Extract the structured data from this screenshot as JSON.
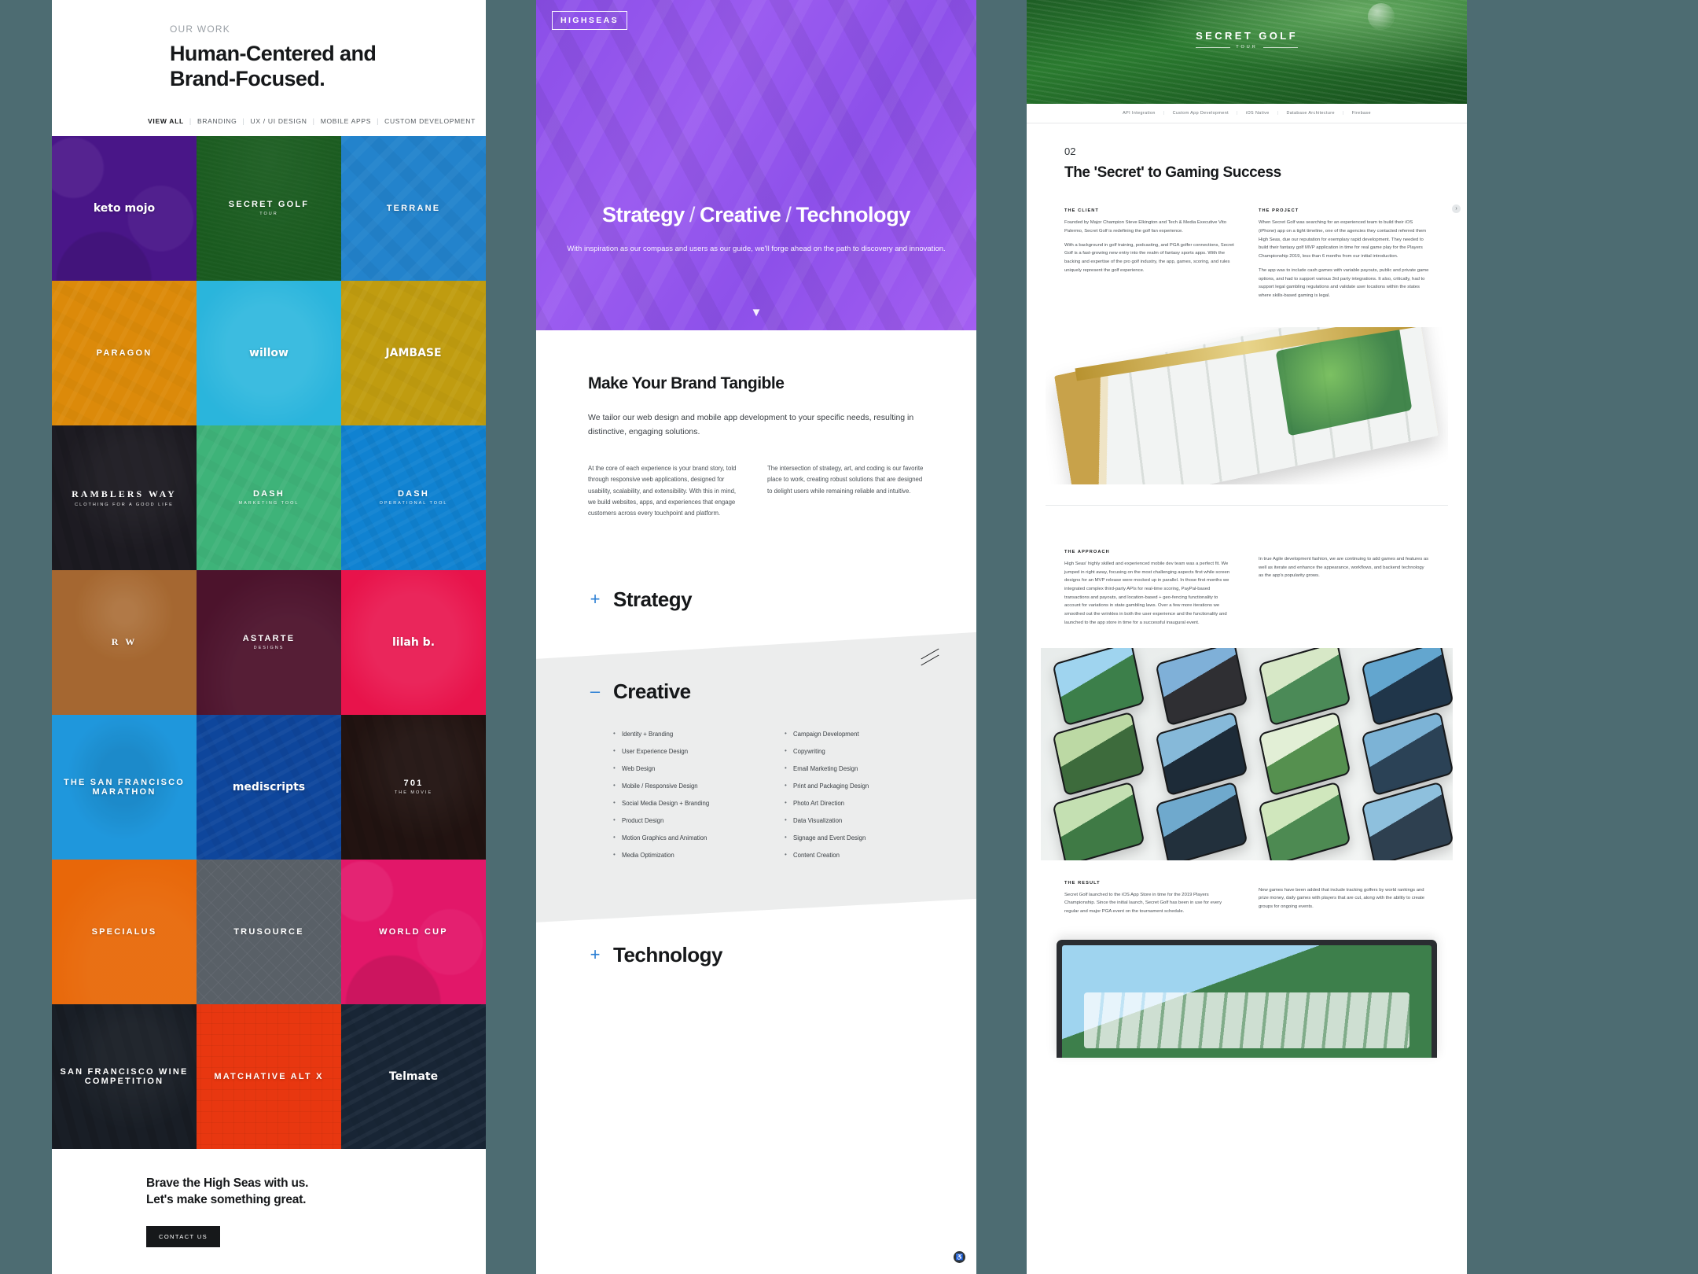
{
  "panel_work": {
    "eyebrow": "OUR WORK",
    "title": "Human-Centered and Brand-Focused.",
    "filters": [
      {
        "label": "VIEW ALL",
        "active": true
      },
      {
        "label": "BRANDING",
        "active": false
      },
      {
        "label": "UX / UI DESIGN",
        "active": false
      },
      {
        "label": "MOBILE APPS",
        "active": false
      },
      {
        "label": "CUSTOM DEVELOPMENT",
        "active": false
      }
    ],
    "tiles": [
      {
        "name": "keto mojo",
        "sub": "",
        "color": "#6b28a8",
        "tex": "tx-photo",
        "style": "script"
      },
      {
        "name": "SECRET GOLF",
        "sub": "TOUR",
        "color": "#2e7d36",
        "tex": "tx-grass",
        "style": "caps"
      },
      {
        "name": "TERRANE",
        "sub": "",
        "color": "#3ba3dd",
        "tex": "tx-iso",
        "style": "caps"
      },
      {
        "name": "PARAGON",
        "sub": "",
        "color": "#e8a913",
        "tex": "tx-doc",
        "style": "caps"
      },
      {
        "name": "willow",
        "sub": "",
        "color": "#45cbe8",
        "tex": "tx-soft",
        "style": "script"
      },
      {
        "name": "JAMBASE",
        "sub": "",
        "color": "#d4b81e",
        "tex": "tx-doc",
        "style": "script"
      },
      {
        "name": "RAMBLERS WAY",
        "sub": "CLOTHING FOR A GOOD LIFE",
        "color": "#33303a",
        "tex": "tx-dark",
        "style": "serif"
      },
      {
        "name": "DASH",
        "sub": "MARKETING TOOL",
        "color": "#5fca9a",
        "tex": "tx-doc",
        "style": "caps"
      },
      {
        "name": "DASH",
        "sub": "OPERATIONAL TOOL",
        "color": "#1fa2e0",
        "tex": "tx-ui",
        "style": "caps"
      },
      {
        "name": "R W",
        "sub": "",
        "color": "#c08a4e",
        "tex": "tx-glow",
        "style": "serif"
      },
      {
        "name": "ASTARTE",
        "sub": "Designs",
        "color": "#6e2348",
        "tex": "tx-blob",
        "style": "caps"
      },
      {
        "name": "lilah b.",
        "sub": "",
        "color": "#f0246d",
        "tex": "tx-soft",
        "style": "script"
      },
      {
        "name": "THE SAN FRANCISCO MARATHON",
        "sub": "",
        "color": "#36b4e8",
        "tex": "tx-runner",
        "style": "caps"
      },
      {
        "name": "mediscripts",
        "sub": "",
        "color": "#1b67b8",
        "tex": "tx-ui",
        "style": "script"
      },
      {
        "name": "701",
        "sub": "THE MOVIE",
        "color": "#3a2420",
        "tex": "tx-dark",
        "style": "caps"
      },
      {
        "name": "SPECIALUS",
        "sub": "",
        "color": "#f08a12",
        "tex": "tx-blob",
        "style": "caps"
      },
      {
        "name": "TRUSOURCE",
        "sub": "",
        "color": "#7c838a",
        "tex": "tx-mesh",
        "style": "caps"
      },
      {
        "name": "WORLD CUP",
        "sub": "",
        "color": "#ec2a8c",
        "tex": "tx-photo",
        "style": "caps"
      },
      {
        "name": "SAN FRANCISCO WINE COMPETITION",
        "sub": "",
        "color": "#2d3540",
        "tex": "tx-dark",
        "style": "caps"
      },
      {
        "name": "MATCHATIVE ALT X",
        "sub": "",
        "color": "#f0561f",
        "tex": "tx-tile",
        "style": "caps"
      },
      {
        "name": "Telmate",
        "sub": "",
        "color": "#2b3f54",
        "tex": "tx-ui",
        "style": "script"
      }
    ],
    "cta_line1": "Brave the High Seas with us.",
    "cta_line2": "Let's make something great.",
    "cta_button": "CONTACT US"
  },
  "panel_services": {
    "logo_primary": "HIGH",
    "logo_secondary": "SEAS",
    "hero_words": [
      "Strategy",
      "Creative",
      "Technology"
    ],
    "hero_sub": "With inspiration as our compass and users as our guide, we'll forge ahead on the path to discovery and innovation.",
    "scroll_icon": "down-arrow-icon",
    "heading": "Make Your Brand Tangible",
    "lead": "We tailor our web design and mobile app development to your specific needs, resulting in distinctive, engaging solutions.",
    "col_left": "At the core of each experience is your brand story, told through responsive web applications, designed for usability, scalability, and extensibility. With this in mind, we build websites, apps, and experiences that engage customers across every touchpoint and platform.",
    "col_right": "The intersection of strategy, art, and coding is our favorite place to work, creating robust solutions that are designed to delight users while remaining reliable and intuitive.",
    "sections": [
      {
        "sign": "+",
        "name": "Strategy"
      },
      {
        "sign": "–",
        "name": "Creative"
      },
      {
        "sign": "+",
        "name": "Technology"
      }
    ],
    "creative_list_left": [
      "Identity + Branding",
      "User Experience Design",
      "Web Design",
      "Mobile / Responsive Design",
      "Social Media Design + Branding",
      "Product Design",
      "Motion Graphics and Animation",
      "Media Optimization"
    ],
    "creative_list_right": [
      "Campaign Development",
      "Copywriting",
      "Email Marketing Design",
      "Print and Packaging Design",
      "Photo Art Direction",
      "Data Visualization",
      "Signage and Event Design",
      "Content Creation"
    ],
    "accessibility_badge": "♿"
  },
  "panel_case": {
    "brand_name": "SECRET GOLF",
    "brand_sub": "TOUR",
    "tags": [
      "API Integration",
      "Custom App Development",
      "iOS Native",
      "Database Architecture",
      "Firebase"
    ],
    "number": "02",
    "title": "The 'Secret' to Gaming Success",
    "blocks": [
      {
        "label": "THE CLIENT",
        "paras": [
          "Founded by Major Champion Steve Elkington and Tech & Media Executive Vito Palermo, Secret Golf is redefining the golf fan experience.",
          "With a background in golf training, podcasting, and PGA golfer connections, Secret Golf is a fast-growing new entry into the realm of fantasy sports apps. With the backing and expertise of the pro golf industry, the app, games, scoring, and rules uniquely represent the golf experience."
        ]
      },
      {
        "label": "THE PROJECT",
        "paras": [
          "When Secret Golf was searching for an experienced team to build their iOS (iPhone) app on a tight timeline, one of the agencies they contacted referred them High Seas, due our reputation for exemplary rapid development. They needed to build their fantasy golf MVP application in time for real game play for the Players Championship 2019, less than 6 months from our initial introduction.",
          "The app was to include cash games with variable payouts, public and private game options, and had to support various 3rd party integrations. It also, critically, had to support legal gambling regulations and validate user locations within the states where skills-based gaming is legal."
        ]
      },
      {
        "label": "THE APPROACH",
        "paras": [
          "High Seas' highly skilled and experienced mobile dev team was a perfect fit. We jumped in right away, focusing on the most challenging aspects first while screen designs for an MVP release were mocked up in parallel. In those first months we integrated complex third-party APIs for real-time scoring, PayPal-based transactions and payouts, and location-based + geo-fencing functionality to account for variations in state gambling laws. Over a few more iterations we smoothed out the wrinkles in both the user experience and the functionality and launched to the app store in time for a successful inaugural event."
        ]
      },
      {
        "label": "",
        "paras": [
          "In true Agile development fashion, we are continuing to add games and features as well as iterate and enhance the appearance, workflows, and backend technology as the app's popularity grows."
        ]
      },
      {
        "label": "THE RESULT",
        "paras": [
          "Secret Golf launched to the iOS App Store in time for the 2019 Players Championship. Since the initial launch, Secret Golf has been in use for every regular and major PGA event on the tournament schedule."
        ]
      },
      {
        "label": "",
        "paras": [
          "New games have been added that include tracking golfers by world rankings and prize money, daily games with players that are cut, along with the ability to create groups for ongoing events."
        ]
      }
    ],
    "scroll_icon": "chevron-right-icon"
  }
}
